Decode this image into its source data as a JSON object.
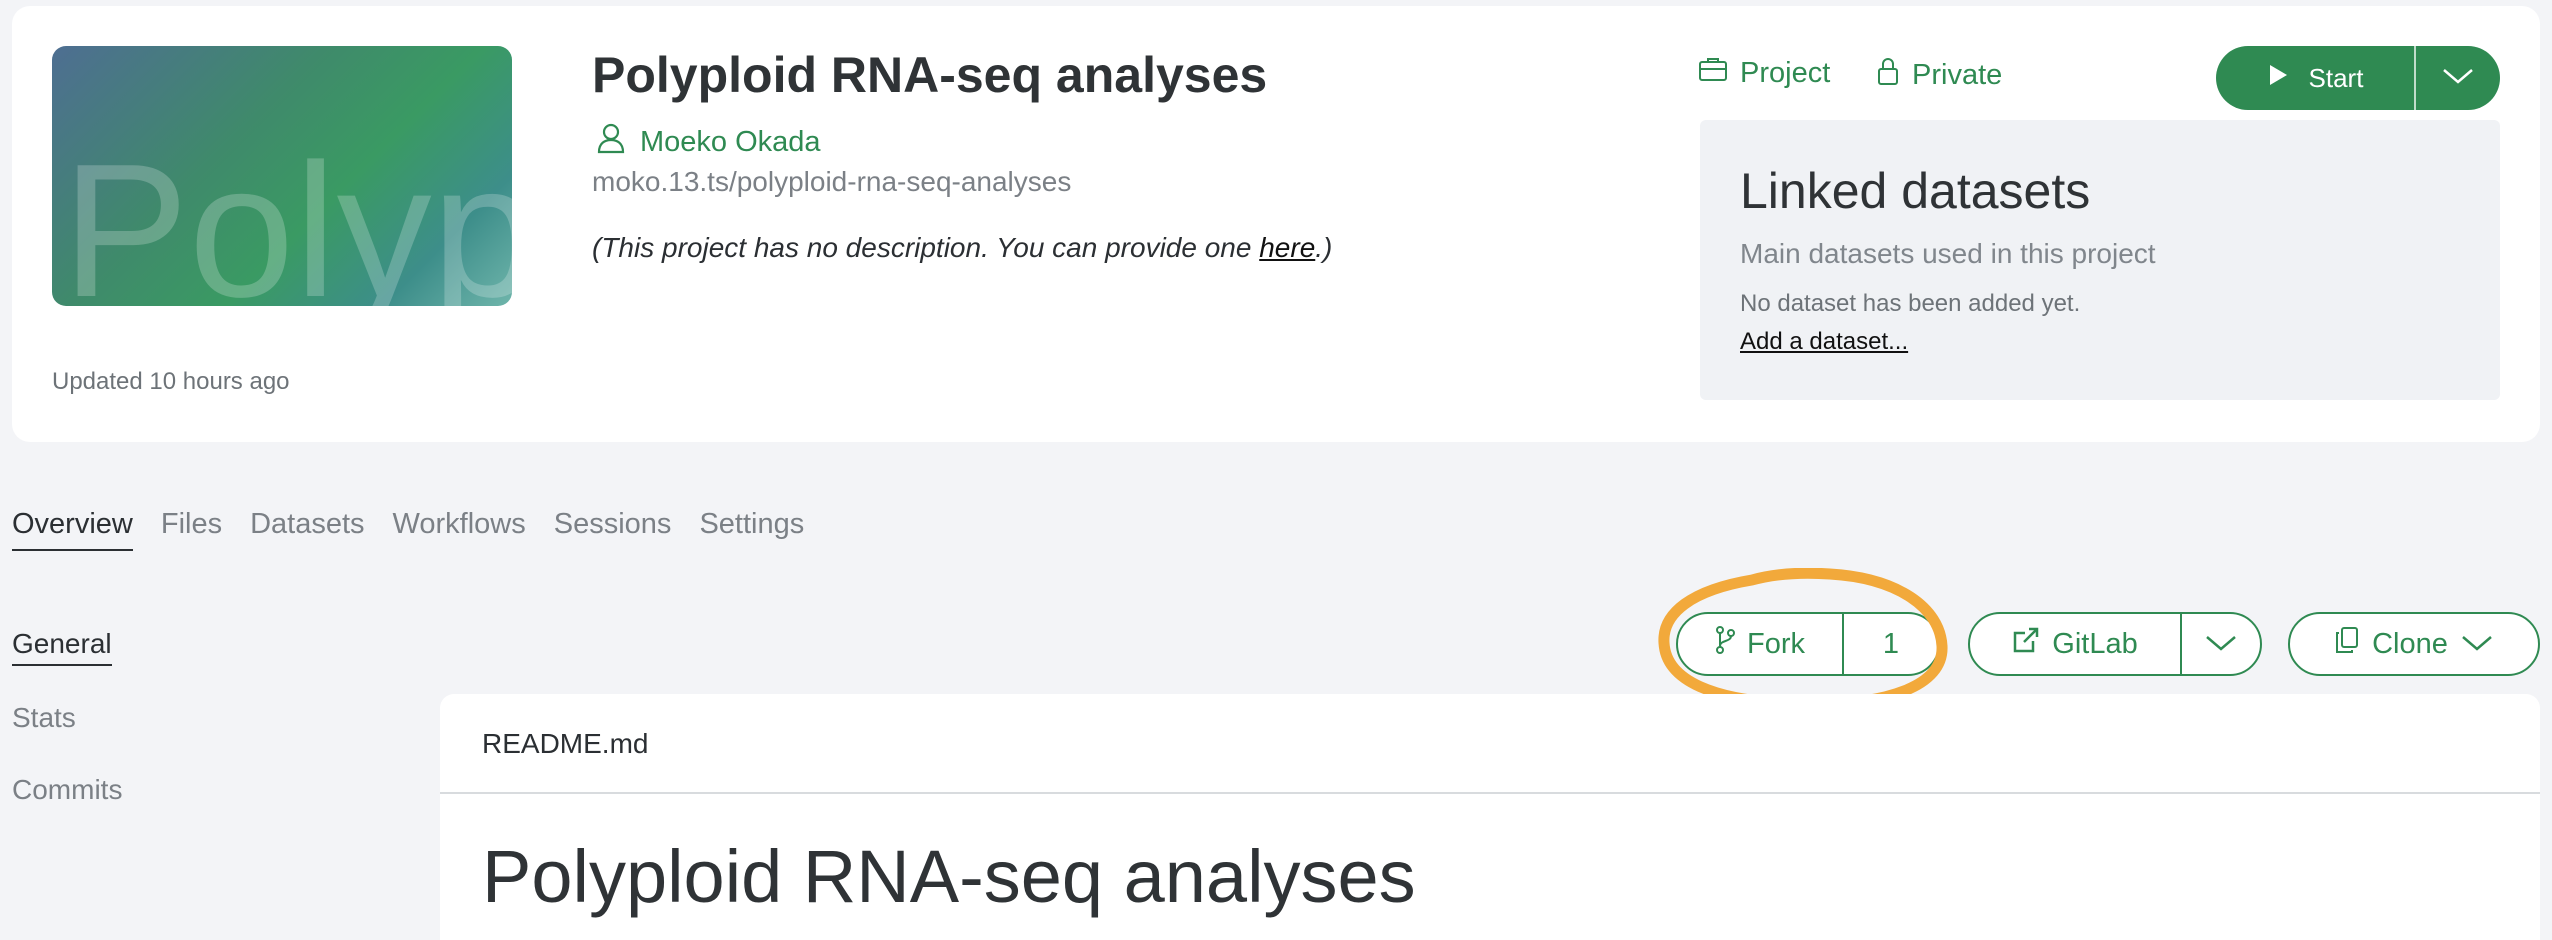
{
  "project": {
    "thumbnail_text": "Polyp",
    "title": "Polyploid RNA-seq analyses",
    "owner": "Moeko Okada",
    "slug": "moko.13.ts/polyploid-rna-seq-analyses",
    "description_prefix": "(This project has no description. You can provide one ",
    "description_link": "here",
    "description_suffix": ".)",
    "updated": "Updated 10 hours ago",
    "type_label": "Project",
    "visibility_label": "Private"
  },
  "start_button": {
    "label": "Start"
  },
  "linked_datasets": {
    "title": "Linked datasets",
    "subtitle": "Main datasets used in this project",
    "empty_text": "No dataset has been added yet.",
    "add_link": "Add a dataset..."
  },
  "tabs": [
    {
      "label": "Overview",
      "active": true
    },
    {
      "label": "Files"
    },
    {
      "label": "Datasets"
    },
    {
      "label": "Workflows"
    },
    {
      "label": "Sessions"
    },
    {
      "label": "Settings"
    }
  ],
  "sidebar": [
    {
      "label": "General",
      "active": true
    },
    {
      "label": "Stats"
    },
    {
      "label": "Commits"
    }
  ],
  "actions": {
    "fork_label": "Fork",
    "fork_count": "1",
    "gitlab_label": "GitLab",
    "clone_label": "Clone"
  },
  "readme": {
    "filename": "README.md",
    "heading": "Polyploid RNA-seq analyses"
  },
  "colors": {
    "accent": "#2f8a52",
    "highlight": "#f2a93b",
    "background": "#f3f4f7"
  },
  "icons": [
    "user-icon",
    "briefcase-icon",
    "lock-icon",
    "play-icon",
    "chevron-down-icon",
    "fork-icon",
    "external-link-icon",
    "copy-icon"
  ]
}
